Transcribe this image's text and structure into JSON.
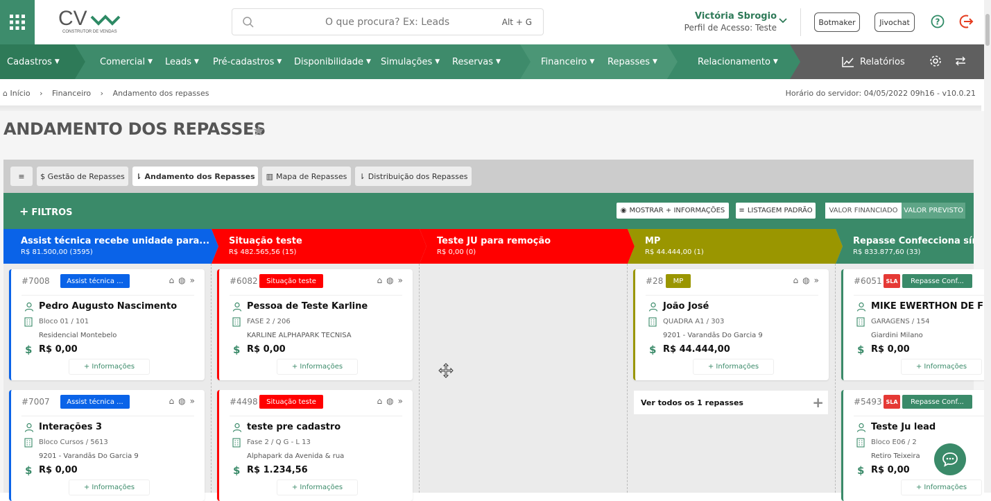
{
  "search": {
    "placeholder": "O que procura? Ex: Leads",
    "shortcut": "Alt + G"
  },
  "logo": {
    "text": "CV",
    "subtitle": "CONSTRUTOR DE VENDAS"
  },
  "user": {
    "name": "Victória Sbrogio",
    "profile": "Perfil de Acesso: Teste"
  },
  "top_buttons": {
    "botmaker": "Botmaker",
    "jivochat": "Jivochat"
  },
  "nav": {
    "cadastros": "Cadastros",
    "comercial": "Comercial",
    "leads": "Leads",
    "pre": "Pré-cadastros",
    "disp": "Disponibilidade",
    "sim": "Simulações",
    "res": "Reservas",
    "fin": "Financeiro",
    "rep": "Repasses",
    "rel": "Relacionamento",
    "relatorios": "Relatórios"
  },
  "breadcrumb": {
    "home": "Início",
    "fin": "Financeiro",
    "current": "Andamento dos repasses",
    "server": "Horário do servidor: 04/05/2022 09h16 - v10.0.21"
  },
  "page_title": "ANDAMENTO DOS REPASSES",
  "tabs": {
    "menu": "≡",
    "gestao": "$ Gestão de Repasses",
    "andamento": "Andamento dos Repasses",
    "mapa": "Mapa de Repasses",
    "dist": "Distribuição dos Repasses"
  },
  "filters": {
    "label": "FILTROS",
    "show_more": "MOSTRAR + INFORMAÇÕES",
    "listing": "LISTAGEM PADRÃO",
    "financed": "VALOR FINANCIADO",
    "expected": "VALOR PREVISTO"
  },
  "colors": {
    "green": "#3a8a69",
    "blue": "#0a63e8",
    "red": "#ff0000",
    "olive": "#9a9600"
  },
  "columns": [
    {
      "title": "Assist técnica recebe unidade para...",
      "sub": "R$ 81.500,00 (3595)"
    },
    {
      "title": "Situação teste",
      "sub": "R$ 482.565,56 (15)"
    },
    {
      "title": "Teste JU para remoção",
      "sub": "R$ 0,00 (0)"
    },
    {
      "title": "MP",
      "sub": "R$ 44.444,00 (1)"
    },
    {
      "title": "Repasse Confecciona sínte",
      "sub": "R$ 833.877,60 (33)"
    }
  ],
  "cards": [
    {
      "id": "#7008",
      "badge": "Assist técnica ...",
      "name": "Pedro Augusto Nascimento",
      "l1": "Bloco 01 / 101",
      "l2": "Residencial Montebelo",
      "val": "R$ 0,00",
      "more": "+ Informações"
    },
    {
      "id": "#7007",
      "badge": "Assist técnica ...",
      "name": "Interações 3",
      "l1": "Bloco Cursos / 5613",
      "l2": "9201 - Varandās Do Garcia 9",
      "val": "R$ 0,00",
      "more": "+ Informações"
    },
    {
      "id": "#6082",
      "badge": "Situação teste",
      "name": "Pessoa de Teste Karline",
      "l1": "FASE 2 / 206",
      "l2": "KARLINE ALPHAPARK TECNISA",
      "val": "R$ 0,00",
      "more": "+ Informações"
    },
    {
      "id": "#4498",
      "badge": "Situação teste",
      "name": "teste pre cadastro",
      "l1": "Fase 2 / Q G - L 13",
      "l2": "Alphapark da Avenida & rua",
      "val": "R$ 1.234,56",
      "more": "+ Informações"
    },
    {
      "id": "#28",
      "badge": "MP",
      "name": "João José",
      "l1": "QUADRA A1 / 303",
      "l2": "9201 - Varandās Do Garcia 9",
      "val": "R$ 44.444,00",
      "more": "+ Informações"
    },
    {
      "id": "#6051",
      "sla": "SLA",
      "badge": "Repasse Conf...",
      "name": "MIKE EWERTHON DE F",
      "l1": "GARAGENS / 154",
      "l2": "Giardini Milano",
      "val": "R$ 0,00",
      "more": "+ Informações"
    },
    {
      "id": "#5493",
      "sla": "SLA",
      "badge": "Repasse Conf...",
      "name": "Teste Ju lead",
      "l1": "Bloco E06 / 2",
      "l2": "Retiro Teixeira",
      "val": "R$ 0,00",
      "more": "+ Informações"
    }
  ],
  "view_all": "Ver todos os 1 repasses"
}
